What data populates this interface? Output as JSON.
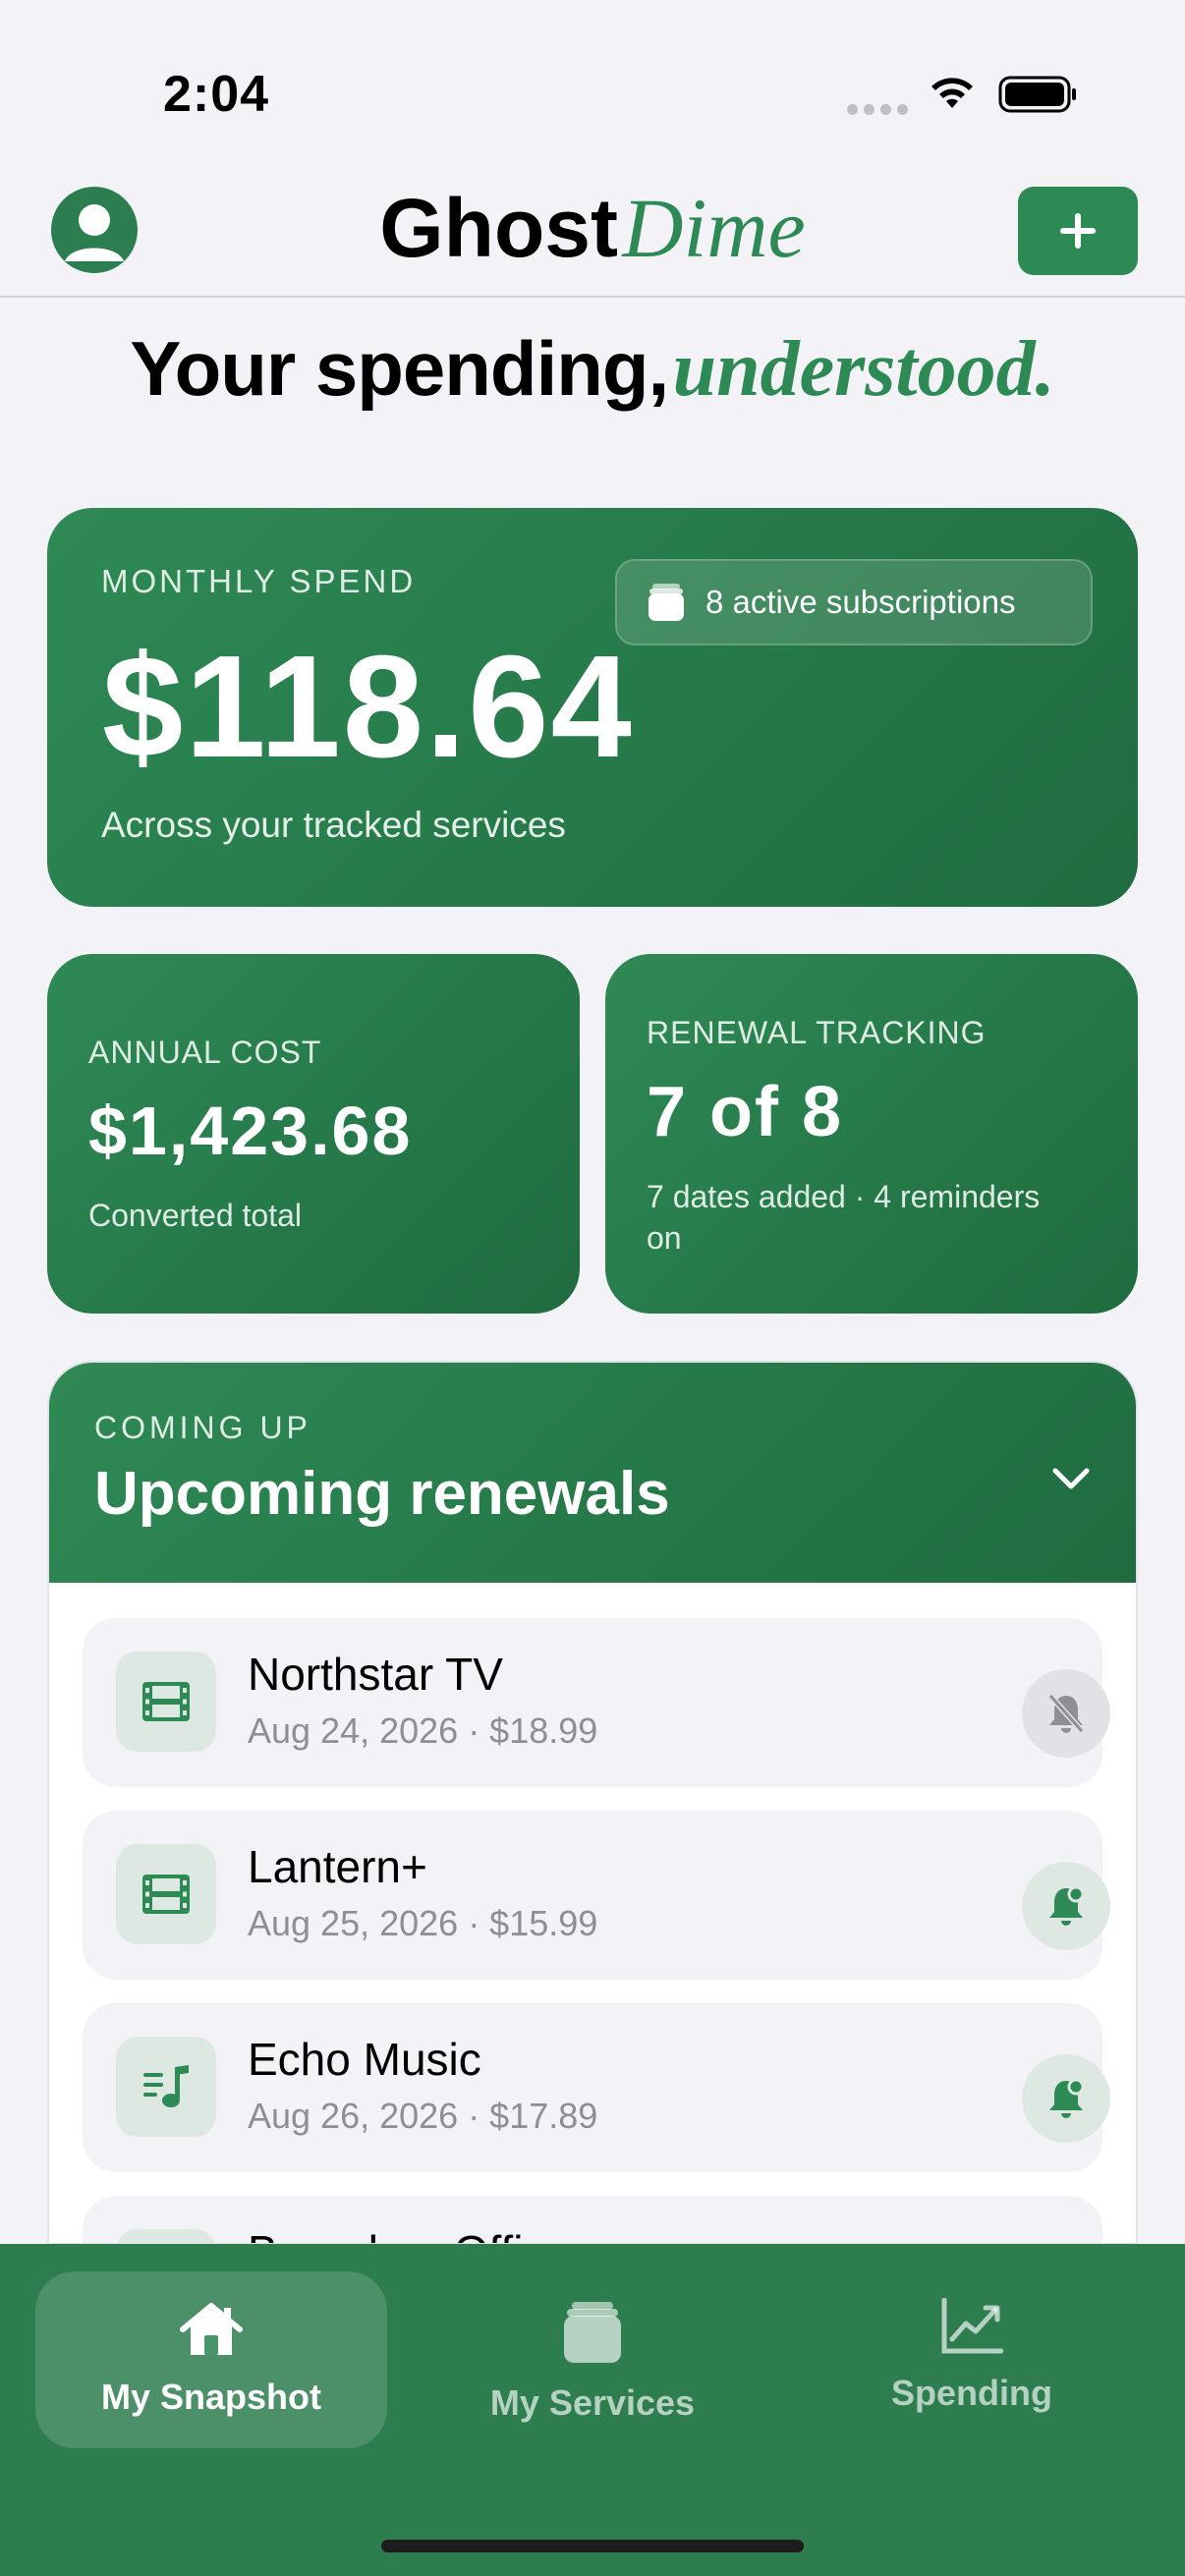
{
  "status_bar": {
    "time": "2:04"
  },
  "header": {
    "brand_main": "Ghost",
    "brand_accent": "Dime",
    "add_label": "+"
  },
  "headline": {
    "main": "Your spending,",
    "accent": "understood."
  },
  "monthly_card": {
    "label": "MONTHLY SPEND",
    "amount": "$118.64",
    "subtitle": "Across your tracked services",
    "subscriptions_badge": "8 active subscriptions"
  },
  "annual_card": {
    "label": "ANNUAL COST",
    "amount": "$1,423.68",
    "subtitle": "Converted total"
  },
  "renewal_card": {
    "label": "RENEWAL TRACKING",
    "value": "7 of 8",
    "subtitle": "7 dates added · 4 reminders on"
  },
  "upcoming": {
    "label": "COMING UP",
    "title": "Upcoming renewals",
    "items": [
      {
        "name": "Northstar TV",
        "meta": "Aug 24, 2026 · $18.99",
        "icon": "film-icon",
        "reminder": "off"
      },
      {
        "name": "Lantern+",
        "meta": "Aug 25, 2026 · $15.99",
        "icon": "film-icon",
        "reminder": "on"
      },
      {
        "name": "Echo Music",
        "meta": "Aug 26, 2026 · $17.89",
        "icon": "music-note-icon",
        "reminder": "on"
      },
      {
        "name": "Boundary Offi",
        "meta": "",
        "icon": "app-icon",
        "reminder": "on"
      }
    ]
  },
  "tabbar": {
    "tabs": [
      {
        "label": "My Snapshot",
        "icon": "house-icon",
        "active": true
      },
      {
        "label": "My Services",
        "icon": "stack-icon",
        "active": false
      },
      {
        "label": "Spending",
        "icon": "chart-line-icon",
        "active": false
      }
    ]
  },
  "colors": {
    "brand_green": "#2e8a55",
    "brand_green_dark": "#1f6b3f",
    "tabbar_green": "#2d7d4f",
    "background": "#f2f2f7"
  }
}
